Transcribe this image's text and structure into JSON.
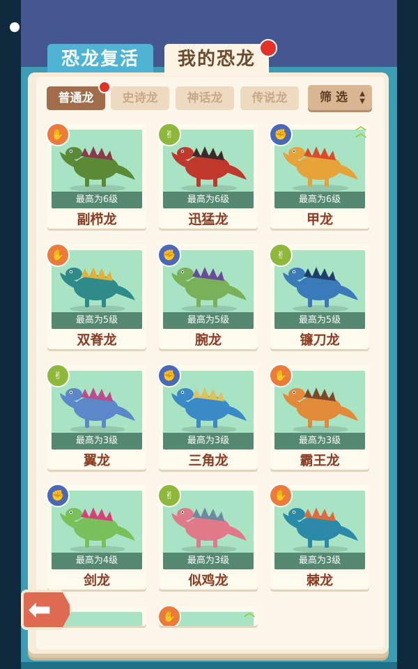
{
  "tabs": [
    {
      "label": "恐龙复活"
    },
    {
      "label": "我的恐龙"
    }
  ],
  "filters": {
    "chips": [
      "普通龙",
      "史诗龙",
      "神话龙",
      "传说龙"
    ],
    "filter_label": "筛 选"
  },
  "cards": [
    {
      "name": "副栉龙",
      "level": "最高为6级",
      "element": "paper",
      "up": false
    },
    {
      "name": "迅猛龙",
      "level": "最高为6级",
      "element": "scissors",
      "up": false
    },
    {
      "name": "甲龙",
      "level": "最高为6级",
      "element": "rock",
      "up": true
    },
    {
      "name": "双脊龙",
      "level": "最高为5级",
      "element": "paper",
      "up": false
    },
    {
      "name": "腕龙",
      "level": "最高为5级",
      "element": "rock",
      "up": false
    },
    {
      "name": "镰刀龙",
      "level": "最高为5级",
      "element": "scissors",
      "up": false
    },
    {
      "name": "翼龙",
      "level": "最高为3级",
      "element": "scissors",
      "up": false
    },
    {
      "name": "三角龙",
      "level": "最高为3级",
      "element": "rock",
      "up": false
    },
    {
      "name": "霸王龙",
      "level": "最高为3级",
      "element": "paper",
      "up": false
    },
    {
      "name": "剑龙",
      "level": "最高为4级",
      "element": "rock",
      "up": false
    },
    {
      "name": "似鸡龙",
      "level": "最高为3级",
      "element": "scissors",
      "up": false
    },
    {
      "name": "棘龙",
      "level": "最高为3级",
      "element": "paper",
      "up": false
    }
  ],
  "colors": {
    "accent_red": "#e53229",
    "card_name": "#8a3c22",
    "art_bg": "#a8e4c4"
  }
}
